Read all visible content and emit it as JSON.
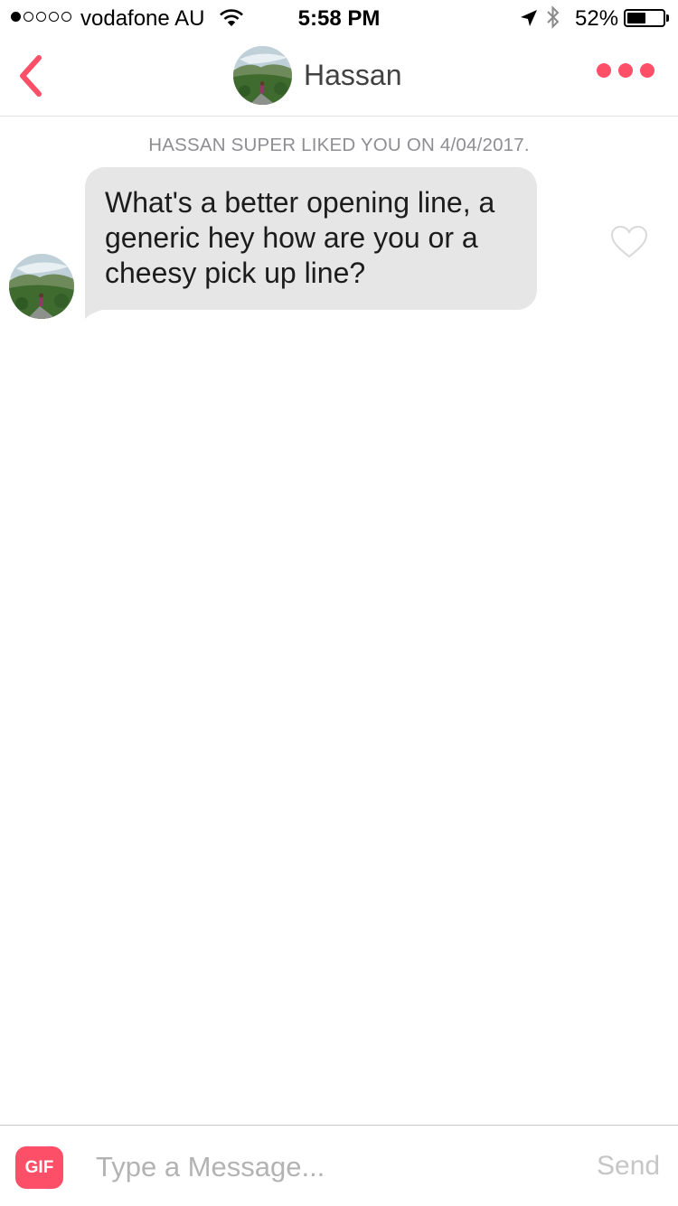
{
  "status_bar": {
    "carrier": "vodafone AU",
    "time": "5:58 PM",
    "battery_text": "52%",
    "battery_level": 0.52,
    "signal_bars_filled": 1,
    "signal_bars_total": 5
  },
  "header": {
    "contact_name": "Hassan",
    "accent_color": "#fd5068",
    "back_icon": "chevron-left-icon",
    "more_icon": "more-dots-icon"
  },
  "conversation": {
    "notice": "HASSAN SUPER LIKED YOU ON 4/04/2017.",
    "messages": [
      {
        "text": "What's a better opening line, a generic hey how are you or a cheesy pick up line?",
        "liked": false
      }
    ]
  },
  "composer": {
    "gif_label": "GIF",
    "placeholder": "Type a Message...",
    "value": "",
    "send_label": "Send"
  }
}
